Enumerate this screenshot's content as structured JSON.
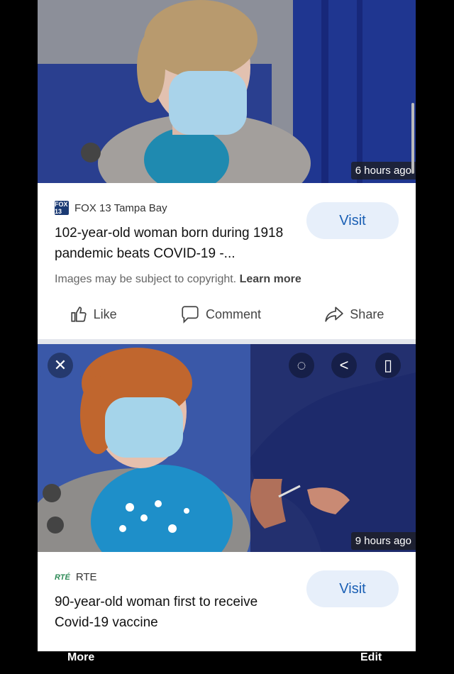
{
  "card1": {
    "time": "6 hours ago",
    "source_logo": "FOX 13",
    "source": "FOX 13 Tampa Bay",
    "headline": "102-year-old woman born during 1918 pandemic beats COVID-19 -...",
    "visit_label": "Visit",
    "copyright_text": "Images may be subject to copyright.",
    "learn_more": "Learn more",
    "like_label": "Like",
    "comment_label": "Comment",
    "share_label": "Share"
  },
  "card2": {
    "time": "9 hours ago",
    "source_logo": "RTÉ",
    "source": "RTE",
    "headline": "90-year-old woman first to receive Covid-19 vaccine",
    "visit_label": "Visit"
  },
  "bottom_bar": {
    "more_label": "More",
    "edit_label": "Edit"
  },
  "colors": {
    "accent": "#1a5fb4",
    "visit_bg": "#e7effa",
    "background": "#000000"
  }
}
